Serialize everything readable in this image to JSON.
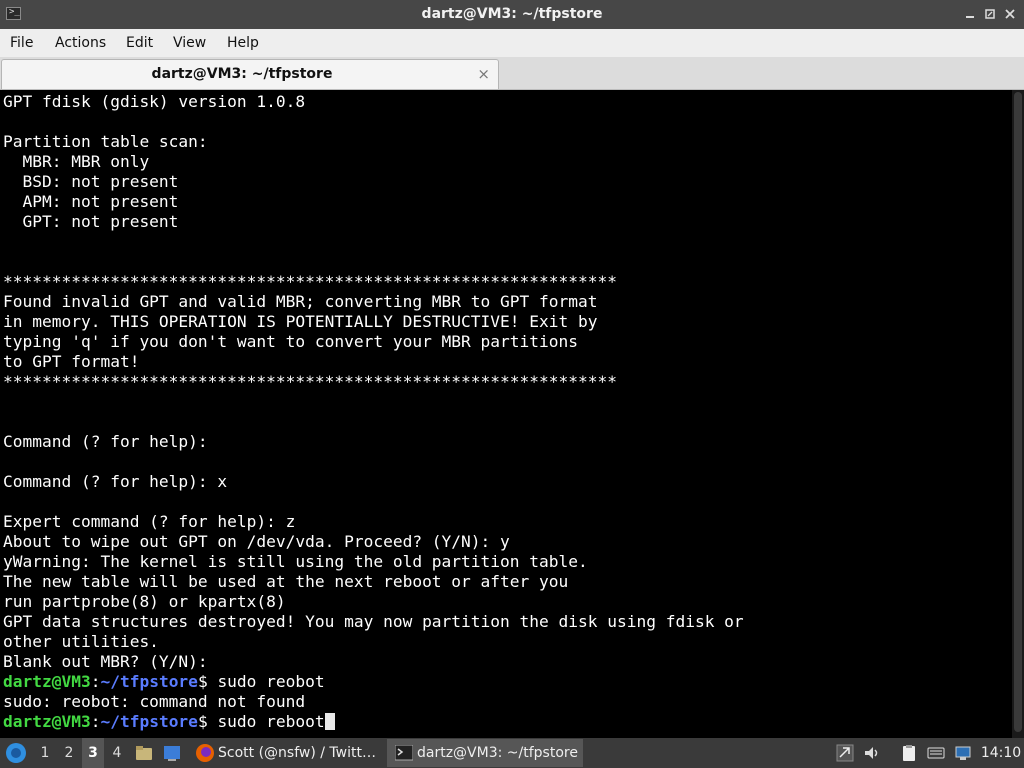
{
  "window": {
    "title": "dartz@VM3: ~/tfpstore"
  },
  "menu": [
    "File",
    "Actions",
    "Edit",
    "View",
    "Help"
  ],
  "tab": {
    "label": "dartz@VM3: ~/tfpstore",
    "close_glyph": "×"
  },
  "terminal": {
    "lines_before_prompt": "GPT fdisk (gdisk) version 1.0.8\n\nPartition table scan:\n  MBR: MBR only\n  BSD: not present\n  APM: not present\n  GPT: not present\n\n\n***************************************************************\nFound invalid GPT and valid MBR; converting MBR to GPT format\nin memory. THIS OPERATION IS POTENTIALLY DESTRUCTIVE! Exit by\ntyping 'q' if you don't want to convert your MBR partitions\nto GPT format!\n***************************************************************\n\n\nCommand (? for help):\n\nCommand (? for help): x\n\nExpert command (? for help): z\nAbout to wipe out GPT on /dev/vda. Proceed? (Y/N): y\nyWarning: The kernel is still using the old partition table.\nThe new table will be used at the next reboot or after you\nrun partprobe(8) or kpartx(8)\nGPT data structures destroyed! You may now partition the disk using fdisk or\nother utilities.\nBlank out MBR? (Y/N): ",
    "prompt_user": "dartz@VM3",
    "prompt_sep": ":",
    "prompt_path": "~/tfpstore",
    "prompt_end": "$ ",
    "cmd1": "sudo reobot",
    "error_line": "sudo: reobot: command not found",
    "cmd2": "sudo reboot"
  },
  "taskbar": {
    "workspaces": [
      "1",
      "2",
      "3",
      "4"
    ],
    "active_workspace": "3",
    "tasks": [
      {
        "label": "Scott (@nsfw) / Twitt…",
        "icon": "firefox-icon"
      },
      {
        "label": "dartz@VM3: ~/tfpstore",
        "icon": "terminal-icon"
      }
    ],
    "clock": "14:10"
  },
  "colors": {
    "prompt_user": "#42d942",
    "prompt_path": "#5a7cff",
    "titlebar": "#474747",
    "taskbar": "#3a3a3a"
  }
}
